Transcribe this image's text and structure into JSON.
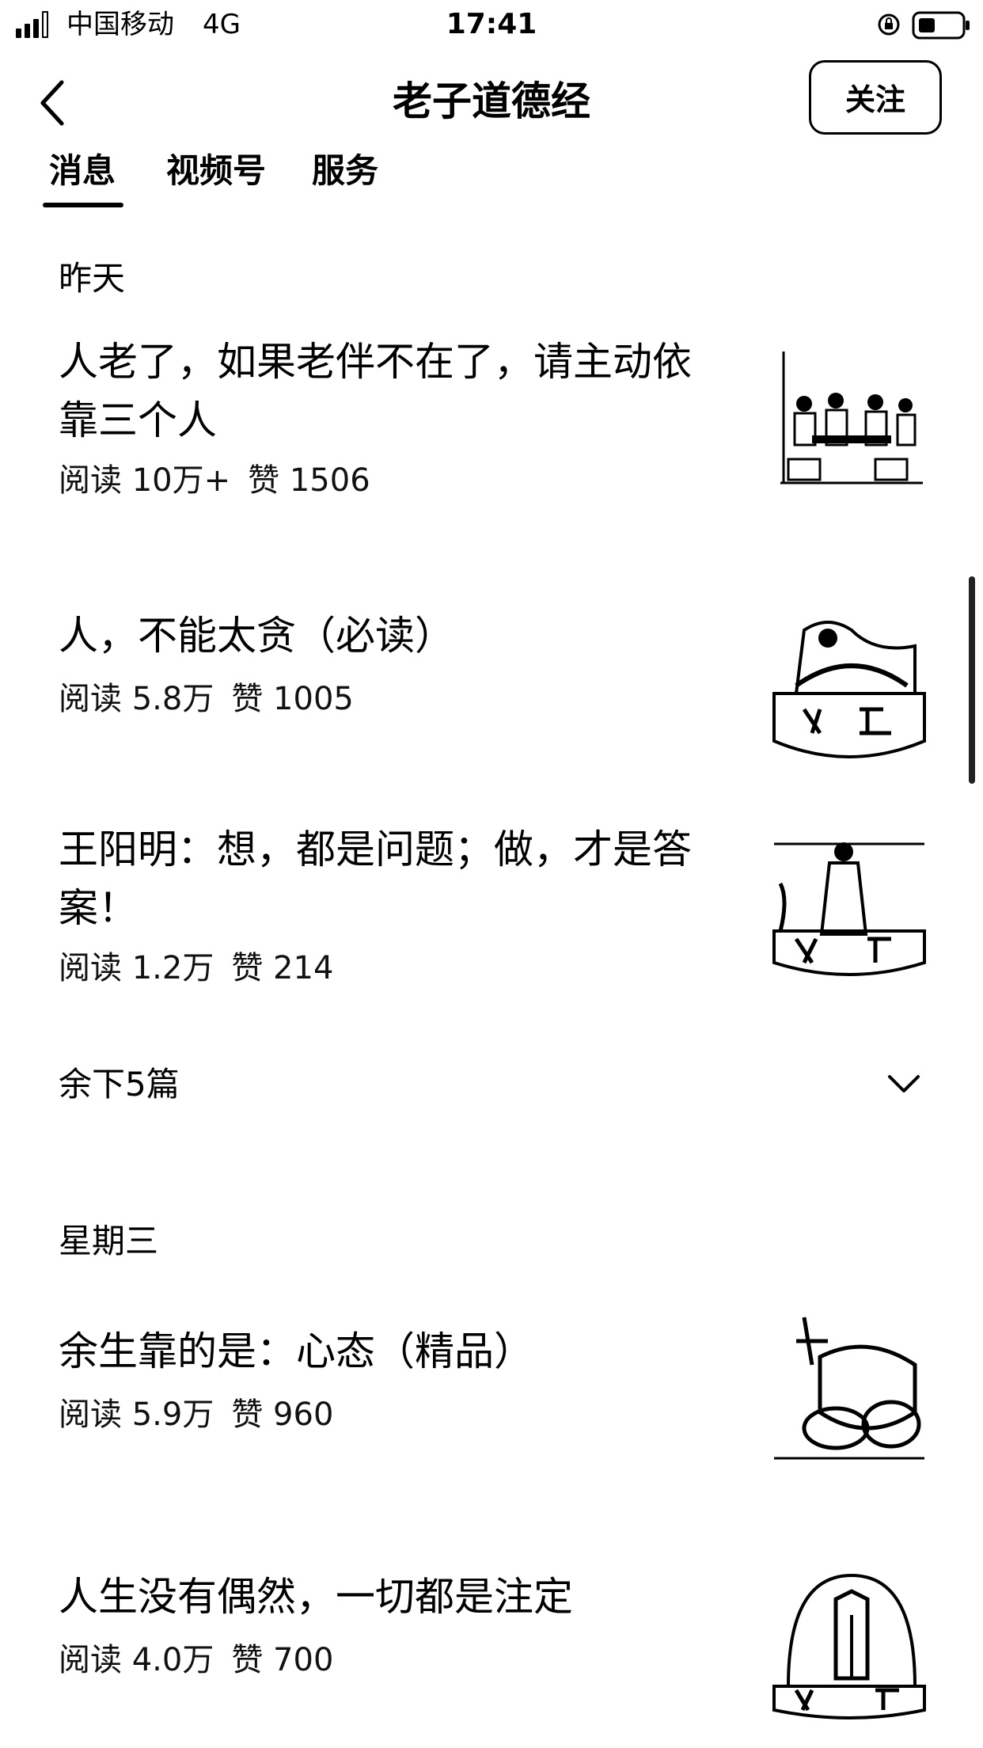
{
  "status_bar": {
    "carrier": "中国移动",
    "network": "4G",
    "time": "17:41",
    "icons": [
      "signal-icon",
      "orientation-lock-icon",
      "battery-icon"
    ]
  },
  "header": {
    "title": "老子道德经",
    "follow_label": "关注"
  },
  "tabs": [
    {
      "label": "消息",
      "active": true
    },
    {
      "label": "视频号",
      "active": false
    },
    {
      "label": "服务",
      "active": false
    }
  ],
  "groups": [
    {
      "date_label": "昨天",
      "articles": [
        {
          "title": "人老了，如果老伴不在了，请主动依靠三个人",
          "reads": "阅读 10万+",
          "likes": "赞 1506"
        },
        {
          "title": "人，不能太贪（必读）",
          "reads": "阅读 5.8万",
          "likes": "赞 1005"
        },
        {
          "title": "王阳明：想，都是问题；做，才是答案！",
          "reads": "阅读 1.2万",
          "likes": "赞 214"
        }
      ],
      "more_label": "余下5篇"
    },
    {
      "date_label": "星期三",
      "articles": [
        {
          "title": "余生靠的是：心态（精品）",
          "reads": "阅读 5.9万",
          "likes": "赞 960"
        },
        {
          "title": "人生没有偶然，一切都是注定",
          "reads": "阅读 4.0万",
          "likes": "赞 700"
        }
      ]
    }
  ]
}
